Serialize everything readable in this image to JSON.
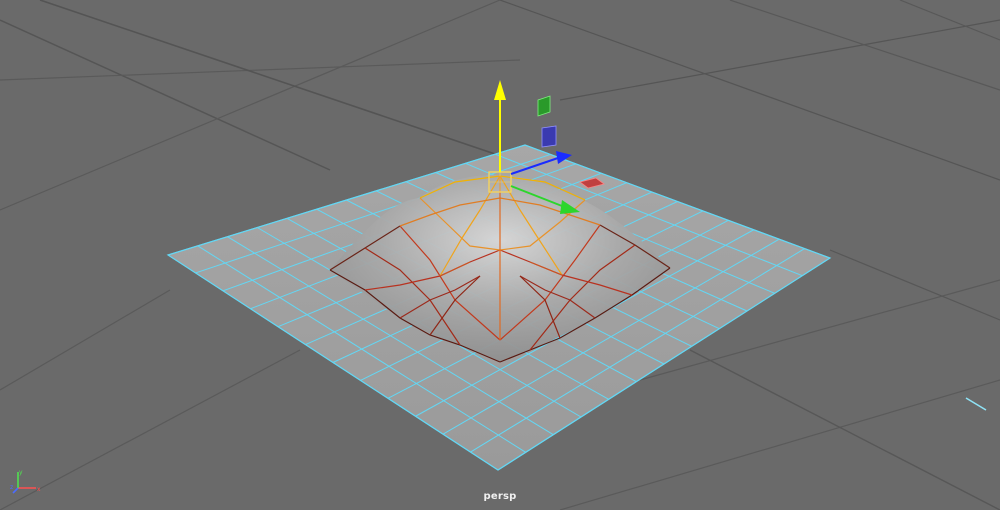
{
  "viewport": {
    "camera_name": "persp",
    "background_color": "#6a6a6a",
    "grid_major_color": "#4a4a4a",
    "wire_color": "#63d7f4"
  },
  "mesh": {
    "object_type": "poly-plane-with-dome",
    "selected_vertex_color": "#f4d35e",
    "soft_select_hot_color": "#f2a200",
    "soft_select_mid_color": "#d64d1e",
    "soft_select_cold_color": "#5a1b12"
  },
  "manipulator": {
    "type": "move-tool",
    "x_color": "#ff4d4d",
    "y_color": "#ffff00",
    "z_color": "#1a2cff",
    "plane_xz_color": "#2a8a2a",
    "plane_xy_color": "#3a3aaa",
    "plane_yz_color": "#c04040",
    "center_color": "#f4f4a0"
  },
  "axis_indicator": {
    "x_color": "#ff5050",
    "y_color": "#50e050",
    "z_color": "#4c6cff"
  }
}
